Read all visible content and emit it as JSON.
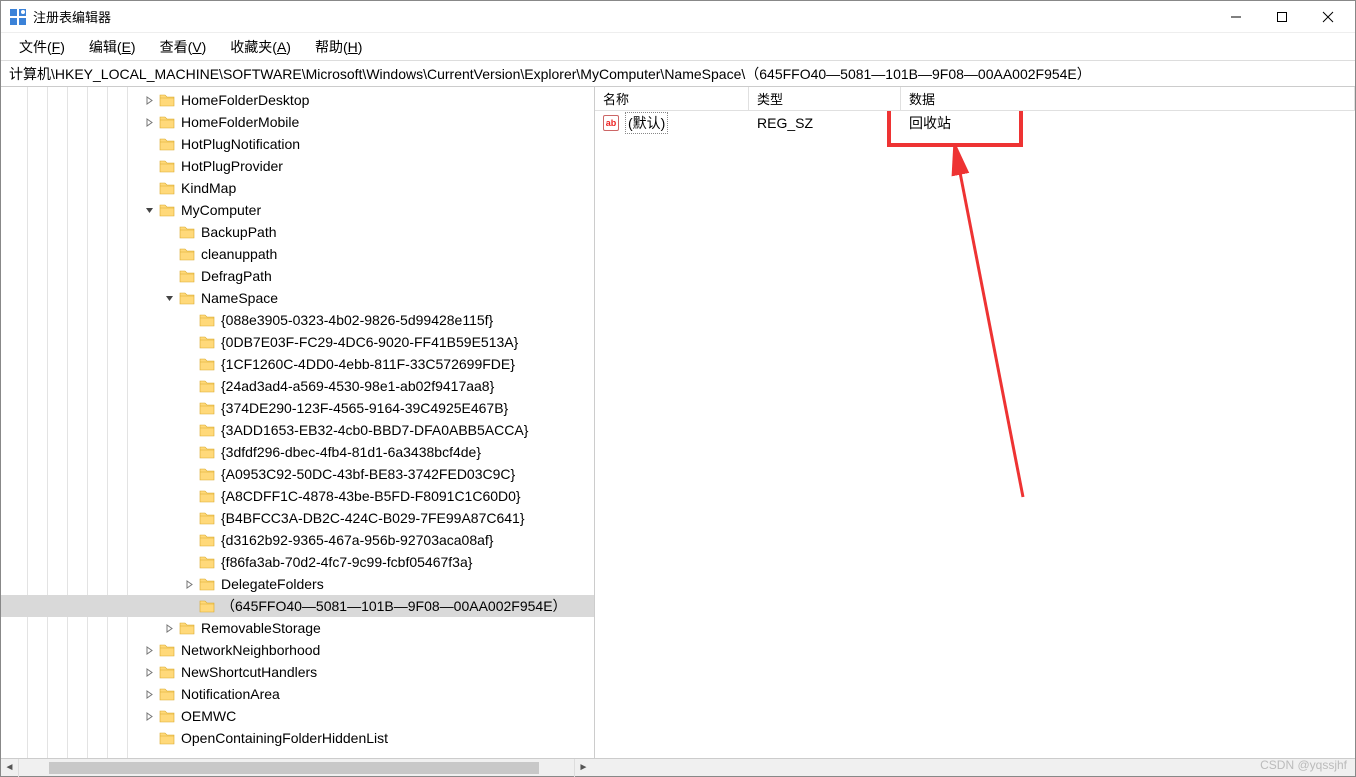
{
  "titlebar": {
    "title": "注册表编辑器"
  },
  "menubar": {
    "file": "文件",
    "file_u": "F",
    "edit": "编辑",
    "edit_u": "E",
    "view": "查看",
    "view_u": "V",
    "fav": "收藏夹",
    "fav_u": "A",
    "help": "帮助",
    "help_u": "H"
  },
  "path": "计算机\\HKEY_LOCAL_MACHINE\\SOFTWARE\\Microsoft\\Windows\\CurrentVersion\\Explorer\\MyComputer\\NameSpace\\（645FFO40—5081—101B—9F08—00AA002F954E）",
  "columns": {
    "name": "名称",
    "type": "类型",
    "data": "数据"
  },
  "value_row": {
    "name": "(默认)",
    "type": "REG_SZ",
    "data": "回收站",
    "icon": "ab"
  },
  "tree": [
    {
      "indent": 7,
      "exp": ">",
      "label": "HomeFolderDesktop"
    },
    {
      "indent": 7,
      "exp": ">",
      "label": "HomeFolderMobile"
    },
    {
      "indent": 7,
      "exp": "",
      "label": "HotPlugNotification"
    },
    {
      "indent": 7,
      "exp": "",
      "label": "HotPlugProvider"
    },
    {
      "indent": 7,
      "exp": "",
      "label": "KindMap"
    },
    {
      "indent": 7,
      "exp": "v",
      "label": "MyComputer"
    },
    {
      "indent": 8,
      "exp": "",
      "label": "BackupPath"
    },
    {
      "indent": 8,
      "exp": "",
      "label": "cleanuppath"
    },
    {
      "indent": 8,
      "exp": "",
      "label": "DefragPath"
    },
    {
      "indent": 8,
      "exp": "v",
      "label": "NameSpace"
    },
    {
      "indent": 9,
      "exp": "",
      "label": "{088e3905-0323-4b02-9826-5d99428e115f}"
    },
    {
      "indent": 9,
      "exp": "",
      "label": "{0DB7E03F-FC29-4DC6-9020-FF41B59E513A}"
    },
    {
      "indent": 9,
      "exp": "",
      "label": "{1CF1260C-4DD0-4ebb-811F-33C572699FDE}"
    },
    {
      "indent": 9,
      "exp": "",
      "label": "{24ad3ad4-a569-4530-98e1-ab02f9417aa8}"
    },
    {
      "indent": 9,
      "exp": "",
      "label": "{374DE290-123F-4565-9164-39C4925E467B}"
    },
    {
      "indent": 9,
      "exp": "",
      "label": "{3ADD1653-EB32-4cb0-BBD7-DFA0ABB5ACCA}"
    },
    {
      "indent": 9,
      "exp": "",
      "label": "{3dfdf296-dbec-4fb4-81d1-6a3438bcf4de}"
    },
    {
      "indent": 9,
      "exp": "",
      "label": "{A0953C92-50DC-43bf-BE83-3742FED03C9C}"
    },
    {
      "indent": 9,
      "exp": "",
      "label": "{A8CDFF1C-4878-43be-B5FD-F8091C1C60D0}"
    },
    {
      "indent": 9,
      "exp": "",
      "label": "{B4BFCC3A-DB2C-424C-B029-7FE99A87C641}"
    },
    {
      "indent": 9,
      "exp": "",
      "label": "{d3162b92-9365-467a-956b-92703aca08af}"
    },
    {
      "indent": 9,
      "exp": "",
      "label": "{f86fa3ab-70d2-4fc7-9c99-fcbf05467f3a}"
    },
    {
      "indent": 9,
      "exp": ">",
      "label": "DelegateFolders"
    },
    {
      "indent": 9,
      "exp": "",
      "label": "（645FFO40—5081—101B—9F08—00AA002F954E）",
      "selected": true
    },
    {
      "indent": 8,
      "exp": ">",
      "label": "RemovableStorage"
    },
    {
      "indent": 7,
      "exp": ">",
      "label": "NetworkNeighborhood"
    },
    {
      "indent": 7,
      "exp": ">",
      "label": "NewShortcutHandlers"
    },
    {
      "indent": 7,
      "exp": ">",
      "label": "NotificationArea"
    },
    {
      "indent": 7,
      "exp": ">",
      "label": "OEMWC"
    },
    {
      "indent": 7,
      "exp": "",
      "label": "OpenContainingFolderHiddenList"
    }
  ],
  "watermark": "CSDN @yqssjhf"
}
